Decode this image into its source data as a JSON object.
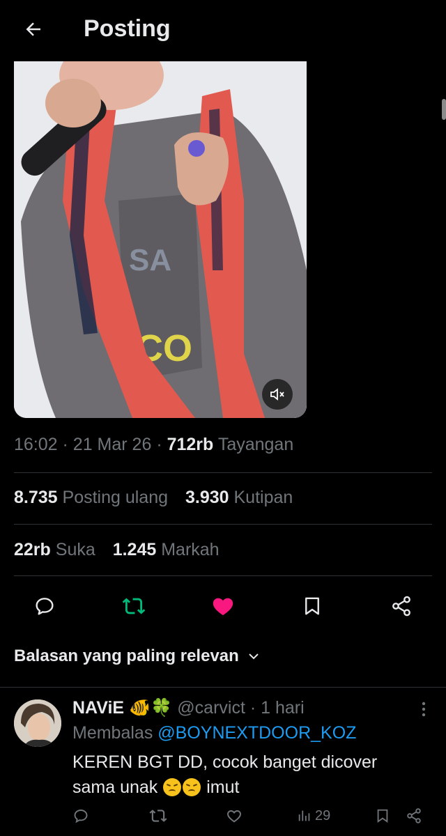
{
  "header": {
    "title": "Posting"
  },
  "meta": {
    "time": "16:02",
    "sep": "·",
    "date": "21 Mar 26",
    "views_value": "712rb",
    "views_label": "Tayangan"
  },
  "stats": {
    "reposts_value": "8.735",
    "reposts_label": "Posting ulang",
    "quotes_value": "3.930",
    "quotes_label": "Kutipan",
    "likes_value": "22rb",
    "likes_label": "Suka",
    "bookmarks_value": "1.245",
    "bookmarks_label": "Markah"
  },
  "colors": {
    "repost_green": "#00ba7c",
    "like_pink": "#f91880",
    "link_blue": "#1d9bf0",
    "muted": "#71767b"
  },
  "relevance": {
    "label": "Balasan yang paling relevan"
  },
  "reply": {
    "name": "NAViE",
    "name_emoji": "🐠🍀",
    "handle": "@carvict",
    "dot": "·",
    "age": "1 hari",
    "replying_prefix": "Membalas",
    "replying_to": "@BOYNEXTDOOR_KOZ",
    "text_line1": "KEREN BGT DD, cocok banget dicover",
    "text_line2_before": "sama unak",
    "text_line2_after": "imut",
    "views": "29"
  },
  "icons": [
    "back-arrow-icon",
    "mute-icon",
    "reply-icon",
    "repost-icon",
    "like-icon",
    "bookmark-icon",
    "share-icon",
    "chevron-down-icon",
    "more-icon",
    "views-icon"
  ]
}
